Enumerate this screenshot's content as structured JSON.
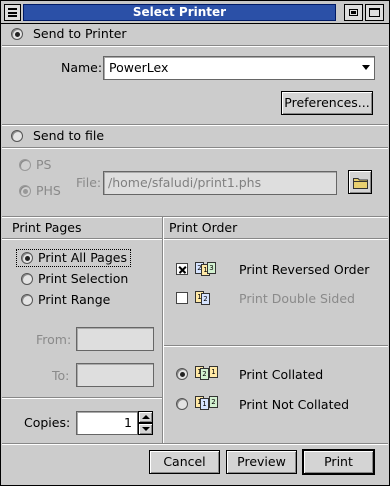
{
  "window": {
    "title": "Select Printer"
  },
  "send_to_printer": {
    "label": "Send to Printer",
    "selected": true,
    "name_label": "Name:",
    "printer_name": "PowerLex",
    "preferences_label": "Preferences..."
  },
  "send_to_file": {
    "label": "Send to file",
    "selected": false,
    "format_ps": "PS",
    "format_phs": "PHS",
    "format_selected": "PHS",
    "file_label": "File:",
    "file_path": "/home/sfaludi/print1.phs"
  },
  "print_pages": {
    "heading": "Print Pages",
    "options": [
      "Print All Pages",
      "Print Selection",
      "Print Range"
    ],
    "selected_index": 0,
    "from_label": "From:",
    "to_label": "To:",
    "from_value": "",
    "to_value": "",
    "copies_label": "Copies:",
    "copies_value": "1"
  },
  "print_order": {
    "heading": "Print Order",
    "reversed_label": "Print Reversed Order",
    "reversed_checked": true,
    "double_sided_label": "Print Double Sided",
    "double_sided_checked": false,
    "collated_label": "Print Collated",
    "not_collated_label": "Print Not Collated",
    "collated_selected": true
  },
  "buttons": {
    "cancel": "Cancel",
    "preview": "Preview",
    "print": "Print"
  },
  "icons": {
    "window_menu": "window-menu-icon",
    "minimize": "minimize-icon",
    "maximize": "maximize-icon",
    "dropdown": "dropdown-arrow-icon",
    "folder": "folder-icon",
    "spin_up": "spin-up-icon",
    "spin_down": "spin-down-icon"
  },
  "colors": {
    "title_bar": "#2b50a7",
    "window_bg": "#cccccc"
  }
}
